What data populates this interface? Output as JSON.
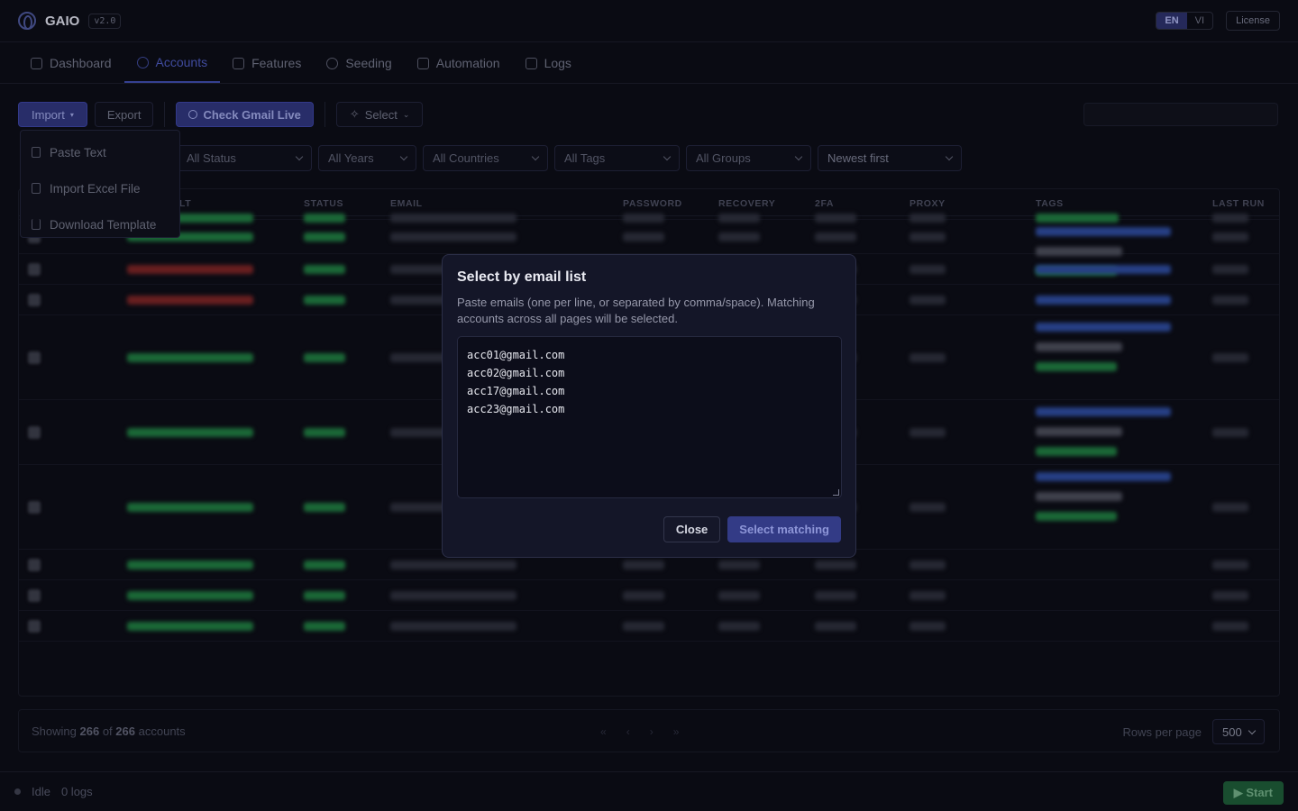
{
  "app": {
    "name": "GAIO",
    "version": "v2.0"
  },
  "header": {
    "languages": [
      {
        "label": "EN",
        "active": true
      },
      {
        "label": "VI",
        "active": false
      }
    ],
    "license_label": "License"
  },
  "nav": {
    "tabs": [
      {
        "label": "Dashboard",
        "icon": "dashboard-icon",
        "active": false
      },
      {
        "label": "Accounts",
        "icon": "users-icon",
        "active": true
      },
      {
        "label": "Features",
        "icon": "sliders-icon",
        "active": false
      },
      {
        "label": "Seeding",
        "icon": "target-icon",
        "active": false
      },
      {
        "label": "Automation",
        "icon": "bolt-icon",
        "active": false
      },
      {
        "label": "Logs",
        "icon": "logs-icon",
        "active": false
      }
    ]
  },
  "toolbar": {
    "import_label": "Import",
    "export_label": "Export",
    "check_label": "Check Gmail Live",
    "select_label": "Select"
  },
  "import_menu": {
    "items": [
      {
        "label": "Paste Text",
        "icon": "clipboard-icon"
      },
      {
        "label": "Import Excel File",
        "icon": "file-icon"
      },
      {
        "label": "Download Template",
        "icon": "download-icon"
      }
    ]
  },
  "filters": {
    "status": "All Status",
    "years": "All Years",
    "countries": "All Countries",
    "tags": "All Tags",
    "groups": "All Groups",
    "sort": "Newest first"
  },
  "table": {
    "columns": [
      "LT",
      "STATUS",
      "EMAIL",
      "PASSWORD",
      "RECOVERY",
      "2FA",
      "PROXY",
      "TAGS",
      "LAST RUN"
    ]
  },
  "footer": {
    "showing_prefix": "Showing",
    "shown": "266",
    "of_label": "of",
    "total": "266",
    "suffix": "accounts",
    "rows_per_page_label": "Rows per page",
    "rows_per_page": "500"
  },
  "statusbar": {
    "state": "Idle",
    "logs": "0 logs",
    "start_label": "▶ Start"
  },
  "modal": {
    "title": "Select by email list",
    "description": "Paste emails (one per line, or separated by comma/space). Matching accounts across all pages will be selected.",
    "textarea_value": "acc01@gmail.com\nacc02@gmail.com\nacc17@gmail.com\nacc23@gmail.com",
    "close_label": "Close",
    "submit_label": "Select matching"
  },
  "colors": {
    "accent": "#3e4aa8",
    "start": "#1d5a36",
    "modal_bg": "#141628"
  }
}
